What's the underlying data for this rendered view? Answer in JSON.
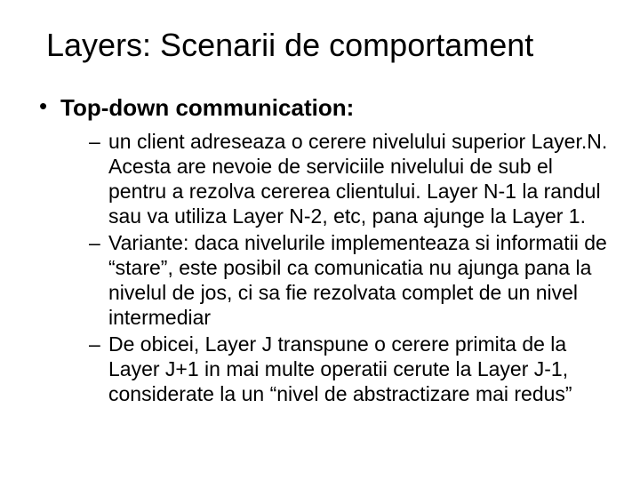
{
  "title": "Layers: Scenarii de comportament",
  "bullet1": "Top-down communication:",
  "sub1": "un client adreseaza o cerere nivelului superior Layer.N. Acesta are nevoie de serviciile nivelului de sub el pentru a rezolva cererea clientului. Layer N-1 la  randul sau va utiliza Layer N-2, etc, pana ajunge la Layer 1.",
  "sub2": "Variante: daca nivelurile implementeaza si informatii de “stare”, este posibil ca  comunicatia nu ajunga pana la nivelul de jos, ci sa fie rezolvata complet de un nivel intermediar",
  "sub3": "De obicei, Layer J transpune o  cerere primita de la Layer J+1 in mai multe operatii cerute la Layer J-1, considerate la un “nivel de abstractizare mai redus”"
}
